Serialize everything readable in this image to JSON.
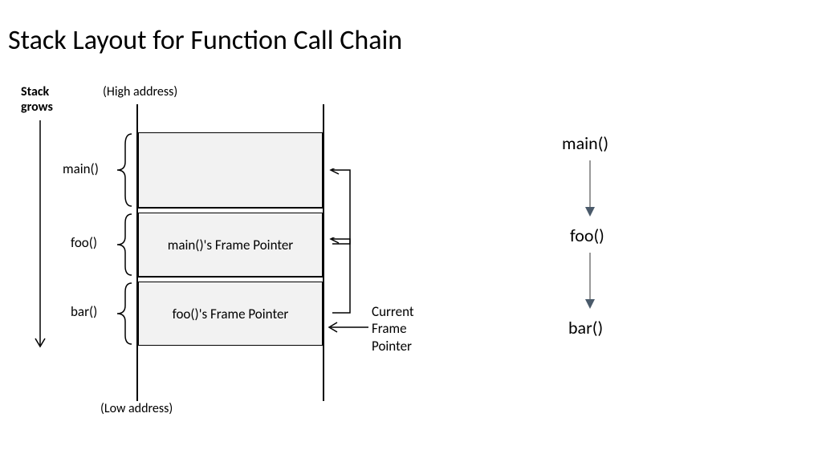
{
  "title": "Stack Layout for Function Call Chain",
  "annotations": {
    "high_address": "(High address)",
    "low_address": "(Low address)",
    "stack_grows": "Stack\ngrows",
    "current_frame_pointer": "Current\nFrame\nPointer"
  },
  "frames": {
    "main": {
      "brace_label": "main()",
      "content": ""
    },
    "foo": {
      "brace_label": "foo()",
      "content": "main()'s Frame Pointer"
    },
    "bar": {
      "brace_label": "bar()",
      "content": "foo()'s Frame Pointer"
    }
  },
  "call_chain": {
    "main": "main()",
    "foo": "foo()",
    "bar": "bar()"
  }
}
